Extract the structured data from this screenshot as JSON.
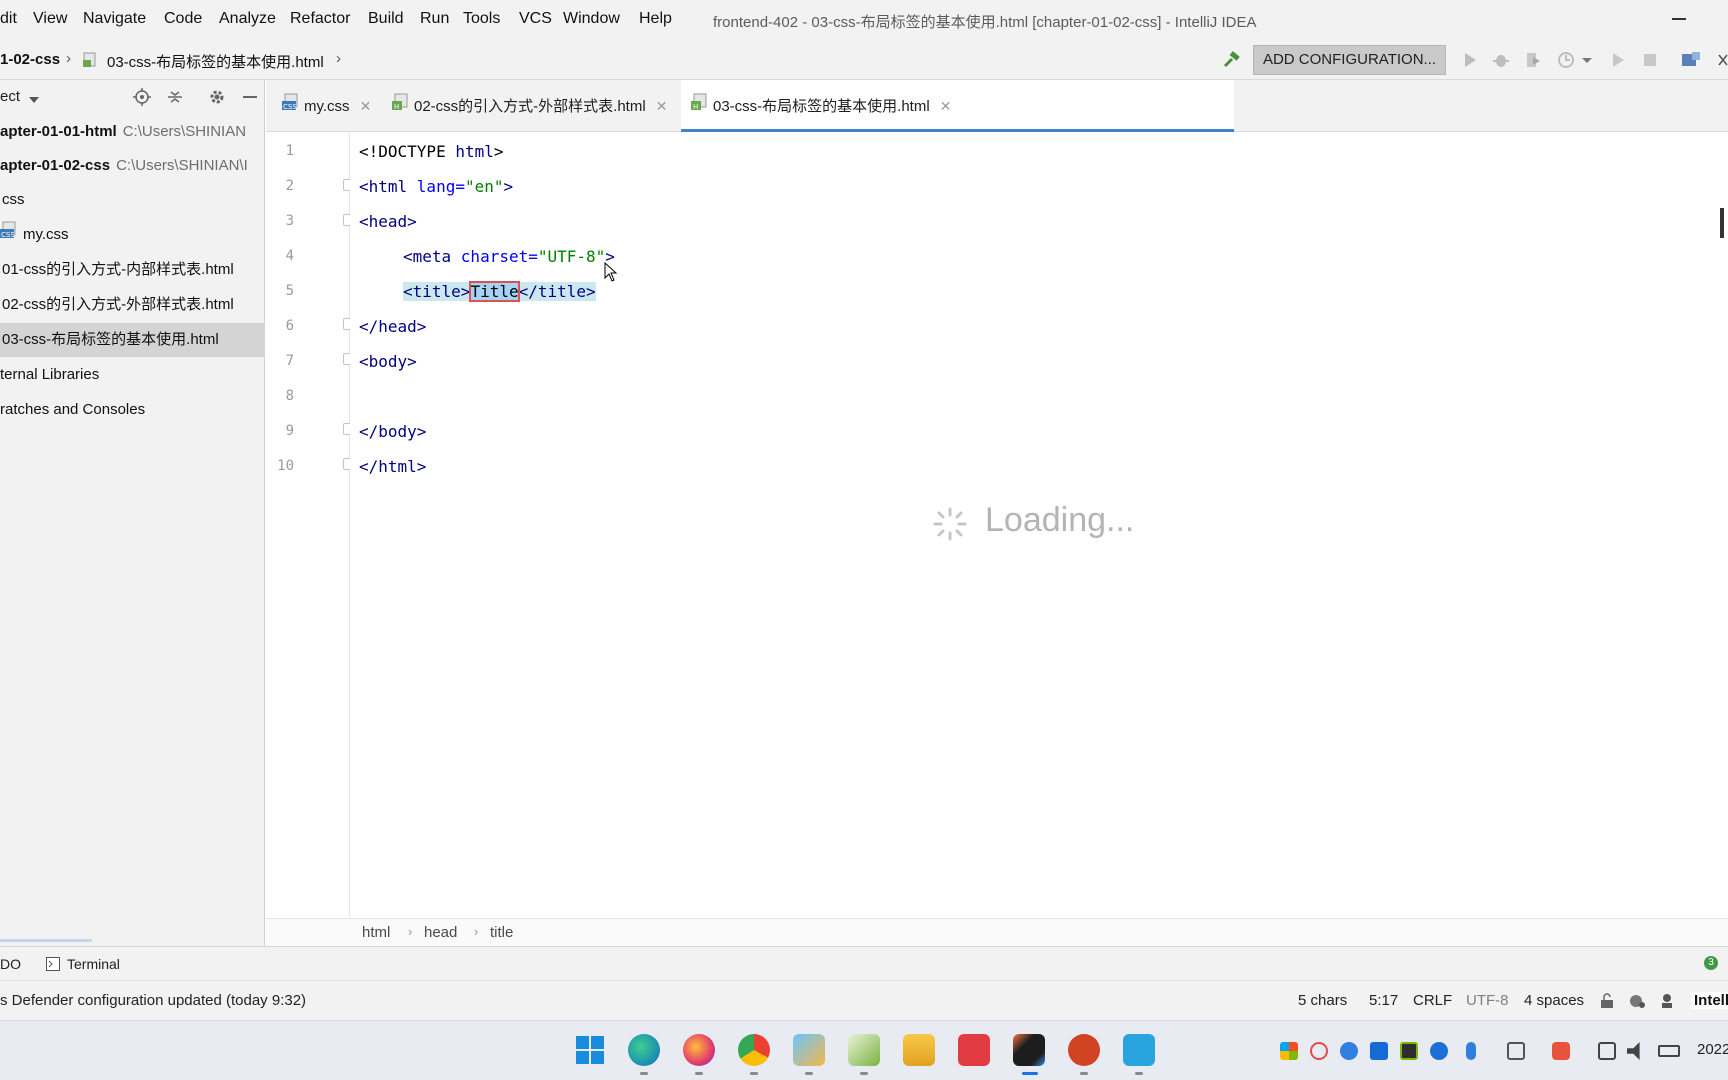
{
  "menubar": {
    "items": [
      "dit",
      "View",
      "Navigate",
      "Code",
      "Analyze",
      "Refactor",
      "Build",
      "Run",
      "Tools",
      "VCS",
      "Window",
      "Help"
    ],
    "window_title": "frontend-402 - 03-css-布局标签的基本使用.html [chapter-01-02-css] - IntelliJ IDEA"
  },
  "navbar": {
    "breadcrumb": [
      "1-02-css",
      "03-css-布局标签的基本使用.html"
    ],
    "add_configuration": "ADD CONFIGURATION..."
  },
  "project_panel": {
    "header_label": "ect",
    "tree": [
      {
        "label": "apter-01-01-html",
        "path": "C:\\Users\\SHINIAN",
        "bold": true
      },
      {
        "label": "apter-01-02-css",
        "path": "C:\\Users\\SHINIAN\\I",
        "bold": true
      },
      {
        "label": "css"
      },
      {
        "label": "my.css"
      },
      {
        "label": "01-css的引入方式-内部样式表.html"
      },
      {
        "label": "02-css的引入方式-外部样式表.html"
      },
      {
        "label": "03-css-布局标签的基本使用.html",
        "selected": true
      },
      {
        "label": "ternal Libraries"
      },
      {
        "label": "ratches and Consoles"
      }
    ]
  },
  "tabs": [
    {
      "label": "my.css",
      "icon": "css-file-icon"
    },
    {
      "label": "02-css的引入方式-外部样式表.html",
      "icon": "html-file-icon"
    },
    {
      "label": "03-css-布局标签的基本使用.html",
      "icon": "html-file-icon",
      "active": true
    }
  ],
  "editor": {
    "line_numbers": [
      "1",
      "2",
      "3",
      "4",
      "5",
      "6",
      "7",
      "8",
      "9",
      "10"
    ],
    "lines": [
      [
        "<!DOCTYPE ",
        "html",
        ">"
      ],
      [
        "<html ",
        "lang=",
        "\"en\"",
        ">"
      ],
      [
        "<head>"
      ],
      [
        "<meta ",
        "charset=",
        "\"UTF-8\"",
        ">"
      ],
      [
        "<title>",
        "Title",
        "</title>"
      ],
      [
        "</head>"
      ],
      [
        "<body>"
      ],
      [
        ""
      ],
      [
        "</body>"
      ],
      [
        "</html>"
      ]
    ],
    "loading_text": "Loading..."
  },
  "editor_breadcrumb": [
    "html",
    "head",
    "title"
  ],
  "toolstrip": {
    "todo": "DO",
    "terminal": "Terminal",
    "event_count": "3"
  },
  "statusbar": {
    "message": "s Defender configuration updated (today 9:32)",
    "chars": "5 chars",
    "position": "5:17",
    "line_sep": "CRLF",
    "encoding": "UTF-8",
    "indent": "4 spaces",
    "product": "Intelli"
  },
  "taskbar": {
    "clock": "2022"
  },
  "colors": {
    "accent": "#4083c9",
    "tag": "#000080",
    "attr": "#0000ff",
    "value": "#008000",
    "selection": "#a6d2f5",
    "match_highlight": "#cbe8ef"
  }
}
